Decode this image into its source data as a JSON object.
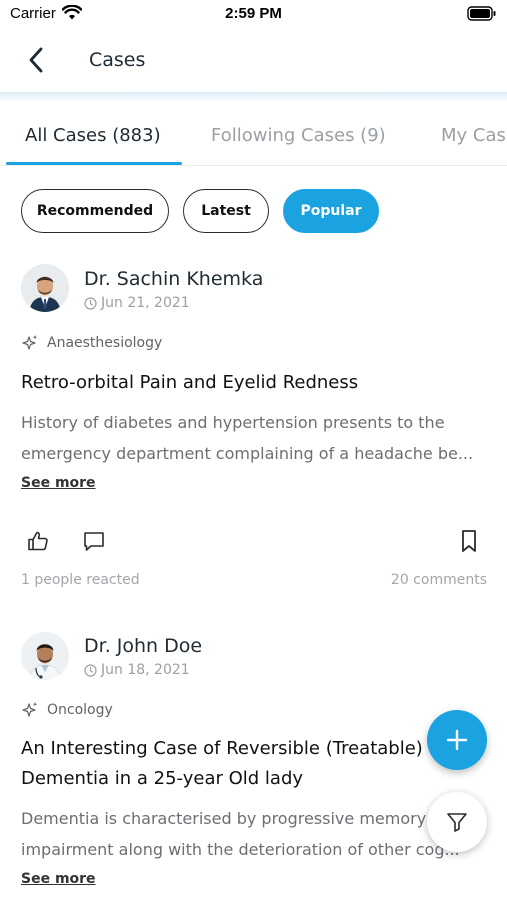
{
  "status_bar": {
    "carrier": "Carrier",
    "time": "2:59 PM"
  },
  "header": {
    "title": "Cases"
  },
  "tabs": [
    {
      "label": "All Cases (883)",
      "active": true
    },
    {
      "label": "Following Cases (9)",
      "active": false
    },
    {
      "label": "My Cases",
      "active": false
    }
  ],
  "filters": [
    {
      "label": "Recommended",
      "active": false
    },
    {
      "label": "Latest",
      "active": false
    },
    {
      "label": "Popular",
      "active": true
    }
  ],
  "cases": [
    {
      "author": "Dr. Sachin Khemka",
      "date": "Jun 21, 2021",
      "specialty": "Anaesthesiology",
      "title": "Retro-orbital Pain and Eyelid Redness",
      "description_line1": "History of diabetes and hypertension presents to the",
      "description_line2": "emergency department complaining of a headache be...",
      "see_more": "See more",
      "reactions": "1 people reacted",
      "comments": "20 comments"
    },
    {
      "author": "Dr. John Doe",
      "date": "Jun 18, 2021",
      "specialty": "Oncology",
      "title_line1": "An Interesting Case of Reversible (Treatable)",
      "title_line2": "Dementia in a 25-year Old lady",
      "description_line1": "Dementia is characterised by progressive memory",
      "description_line2": "impairment along with the deterioration of other cog...",
      "see_more": "See more"
    }
  ],
  "colors": {
    "accent": "#1aa3e0",
    "text_primary": "#1f2a33",
    "text_muted": "#9aa0a6"
  },
  "icons": {
    "back": "chevron-left-icon",
    "like": "thumbs-up-icon",
    "comment": "comment-icon",
    "bookmark": "bookmark-icon",
    "add": "plus-icon",
    "filter": "filter-icon",
    "specialty": "sparkle-icon",
    "date": "clock-icon"
  }
}
